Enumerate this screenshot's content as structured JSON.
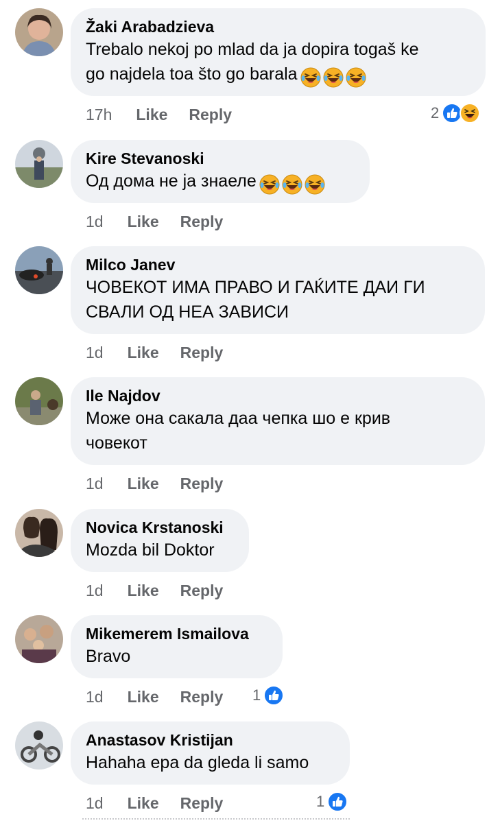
{
  "comments": [
    {
      "name": "Žaki Arabadzieva",
      "text_lines": [
        "Trebalo nekoj po mlad da ja dopira togaš ke",
        "go najdela toa što go barala"
      ],
      "emoji_count": 3,
      "time": "17h",
      "like": "Like",
      "reply": "Reply",
      "reaction_count": "2",
      "reactions": [
        "like-icon",
        "haha-icon"
      ]
    },
    {
      "name": "Kire Stevanoski",
      "text_lines": [
        "Од дома не ја знаеле"
      ],
      "emoji_count": 3,
      "time": "1d",
      "like": "Like",
      "reply": "Reply"
    },
    {
      "name": "Milco Janev",
      "text_lines": [
        "ЧОВЕКОТ ИМА ПРАВО И ГАЌИТЕ ДАИ ГИ",
        "СВАЛИ ОД НЕА ЗАВИСИ"
      ],
      "time": "1d",
      "like": "Like",
      "reply": "Reply"
    },
    {
      "name": "Ile Najdov",
      "text_lines": [
        "Може она сакала даа чепка шо е крив",
        "човекот"
      ],
      "time": "1d",
      "like": "Like",
      "reply": "Reply"
    },
    {
      "name": "Novica Krstanoski",
      "text_lines": [
        "Mozda bil Doktor"
      ],
      "time": "1d",
      "like": "Like",
      "reply": "Reply"
    },
    {
      "name": "Mikemerem Ismailova",
      "text_lines": [
        "Bravo"
      ],
      "time": "1d",
      "like": "Like",
      "reply": "Reply",
      "reaction_count": "1",
      "reactions": [
        "like-icon"
      ]
    },
    {
      "name": "Anastasov Kristijan",
      "text_lines": [
        "Hahaha epa da gleda li samo"
      ],
      "time": "1d",
      "like": "Like",
      "reply": "Reply",
      "reaction_count": "1",
      "reactions": [
        "like-icon"
      ]
    }
  ],
  "colors": {
    "bubble": "#f0f2f5",
    "meta": "#65676b",
    "like_blue": "#1877f2",
    "haha_yellow": "#f7b125"
  }
}
